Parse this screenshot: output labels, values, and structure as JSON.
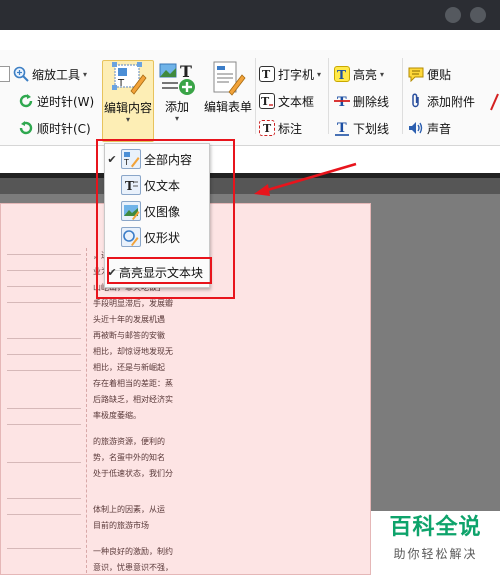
{
  "ribbon": {
    "zoom_tool": "缩放工具",
    "rotate_ccw": "逆时针(W)",
    "rotate_cw": "顺时针(C)",
    "edit_content": "编辑内容",
    "add": "添加",
    "edit_form": "编辑表单",
    "typewriter": "打字机",
    "textbox": "文本框",
    "callout": "标注",
    "highlight": "高亮",
    "strikeout": "删除线",
    "underline": "下划线",
    "note": "便贴",
    "attach": "添加附件",
    "sound": "声音"
  },
  "menu": {
    "items": [
      {
        "label": "全部内容",
        "checked": true
      },
      {
        "label": "仅文本",
        "checked": false
      },
      {
        "label": "仅图像",
        "checked": false
      },
      {
        "label": "仅形状",
        "checked": false
      }
    ],
    "highlight_item": {
      "label": "高亮显示文本块",
      "checked": true
    }
  },
  "document": {
    "lines": [
      "，进行着旅游客源的",
      "业为支柱产业的江西",
      "山屹山，靠天吃饭」",
      "手段明显滞后，发展瓣",
      "头近十年的发展机遇",
      "再被断与邮答的安徽",
      "相比，却惊讶地发现无",
      "相比，还是与新崛起",
      "存在着相当的差距：蒸",
      "后路缺乏，相对经济实",
      "率极度萎缩。",
      "的旅游资源，便利的",
      "势，名蛋中外的知名",
      "处于低速状态，我们分",
      "体制上的因素，从运",
      "目前的旅游市场",
      "一种良好的激励，制约",
      "意识，忧患意识不强，"
    ]
  },
  "watermark": {
    "title": "百科全说",
    "subtitle": "助你轻松解决"
  },
  "colors": {
    "highlight_frame": "#e8141c",
    "watermark_green": "#0ea36b",
    "page_bg": "#fde4e4"
  }
}
